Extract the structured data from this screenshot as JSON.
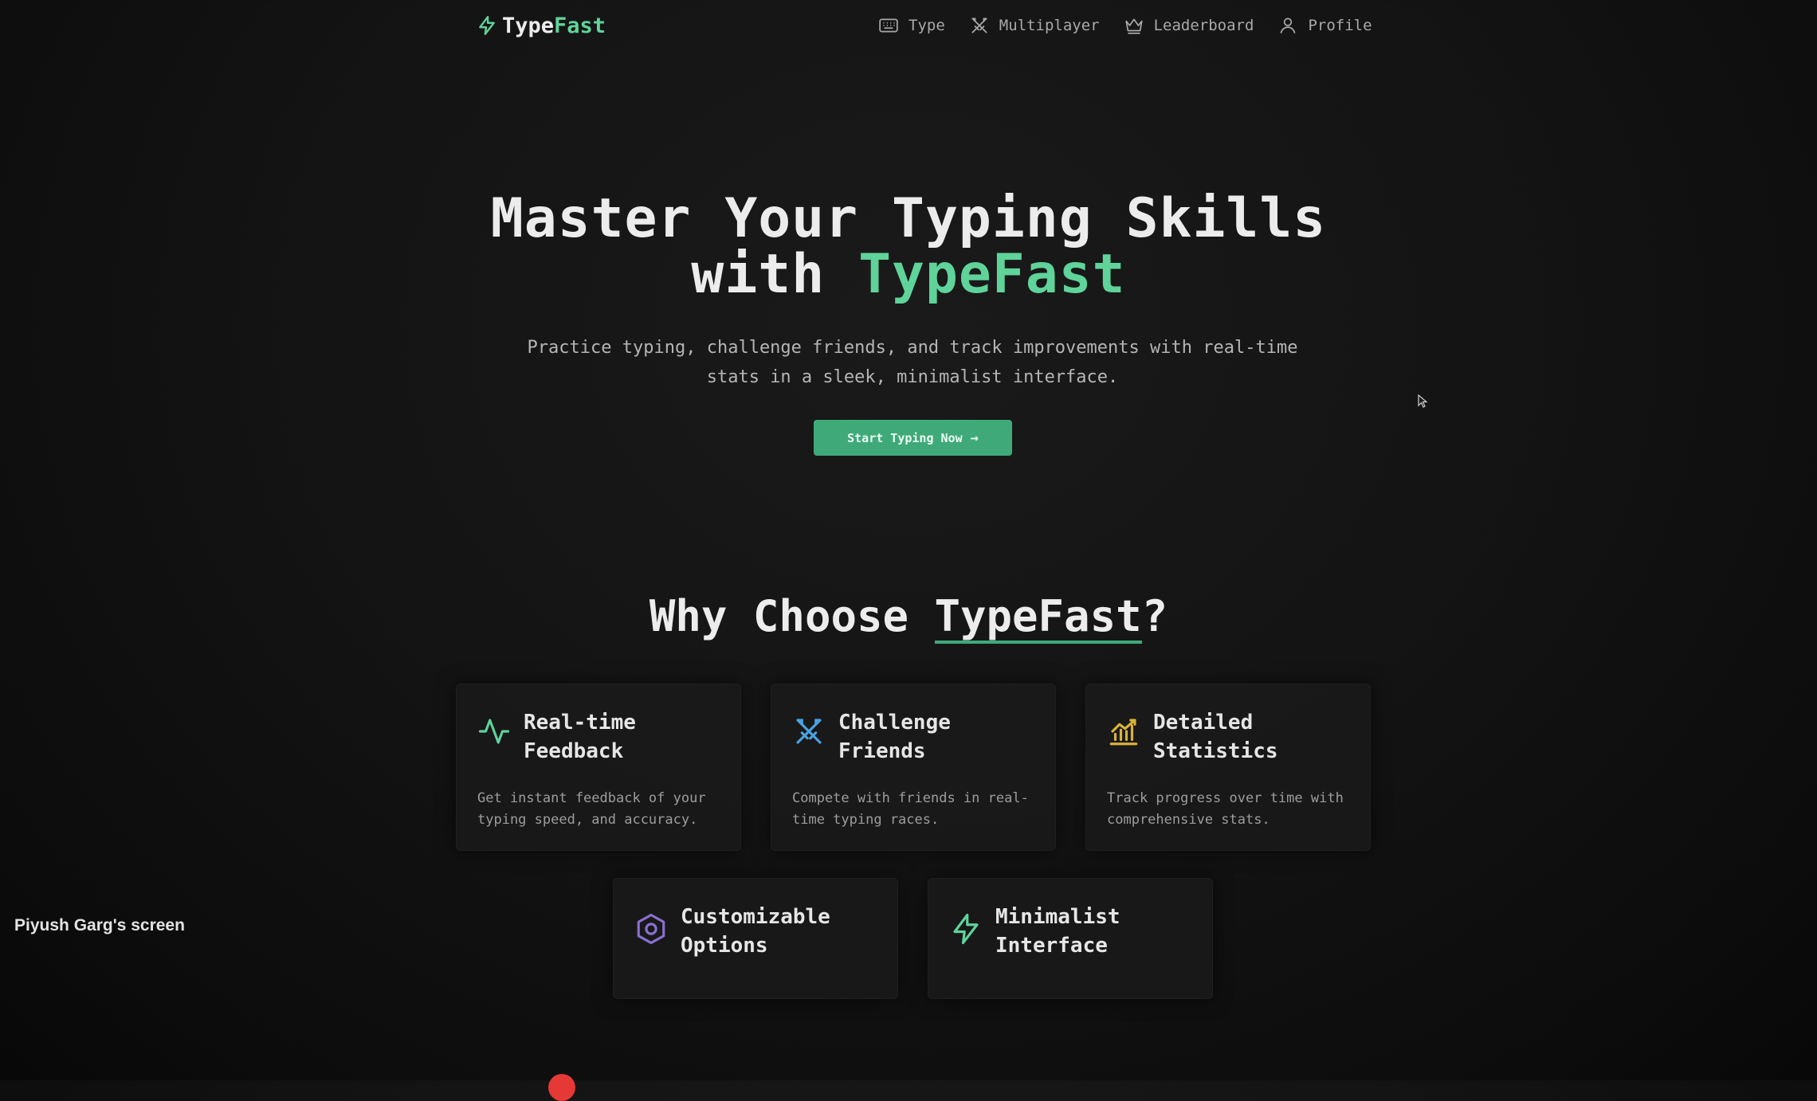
{
  "app": {
    "logo_prefix": "Type",
    "logo_accent": "Fast",
    "accent_color": "#5fd39a",
    "button_color": "#3fa97a"
  },
  "nav": {
    "items": [
      {
        "label": "Type",
        "icon": "keyboard-icon"
      },
      {
        "label": "Multiplayer",
        "icon": "crossed-swords-icon"
      },
      {
        "label": "Leaderboard",
        "icon": "crown-icon"
      },
      {
        "label": "Profile",
        "icon": "user-icon"
      }
    ]
  },
  "hero": {
    "title_line1": "Master Your Typing Skills",
    "title_line2_prefix": "with ",
    "title_line2_accent": "TypeFast",
    "subtitle": "Practice typing, challenge friends, and track improvements with real-time stats in a sleek, minimalist interface.",
    "cta_label": "Start Typing Now",
    "cta_arrow": "→"
  },
  "features": {
    "heading_prefix": "Why Choose ",
    "heading_accent": "TypeFast",
    "heading_suffix": "?",
    "cards": [
      {
        "title": "Real-time Feedback",
        "description": "Get instant feedback of your typing speed, and accuracy.",
        "icon": "activity-pulse-icon",
        "icon_color": "#5fd39a"
      },
      {
        "title": "Challenge Friends",
        "description": "Compete with friends in real-time typing races.",
        "icon": "crossed-swords-icon",
        "icon_color": "#4aa3e0"
      },
      {
        "title": "Detailed Statistics",
        "description": "Track progress over time with comprehensive stats.",
        "icon": "bar-chart-icon",
        "icon_color": "#d9b23a"
      },
      {
        "title": "Customizable Options",
        "description": "",
        "icon": "settings-hexagon-icon",
        "icon_color": "#8a6fd1"
      },
      {
        "title": "Minimalist Interface",
        "description": "",
        "icon": "lightning-icon",
        "icon_color": "#5fd39a"
      }
    ]
  },
  "overlay": {
    "screen_label": "Piyush Garg's screen"
  }
}
